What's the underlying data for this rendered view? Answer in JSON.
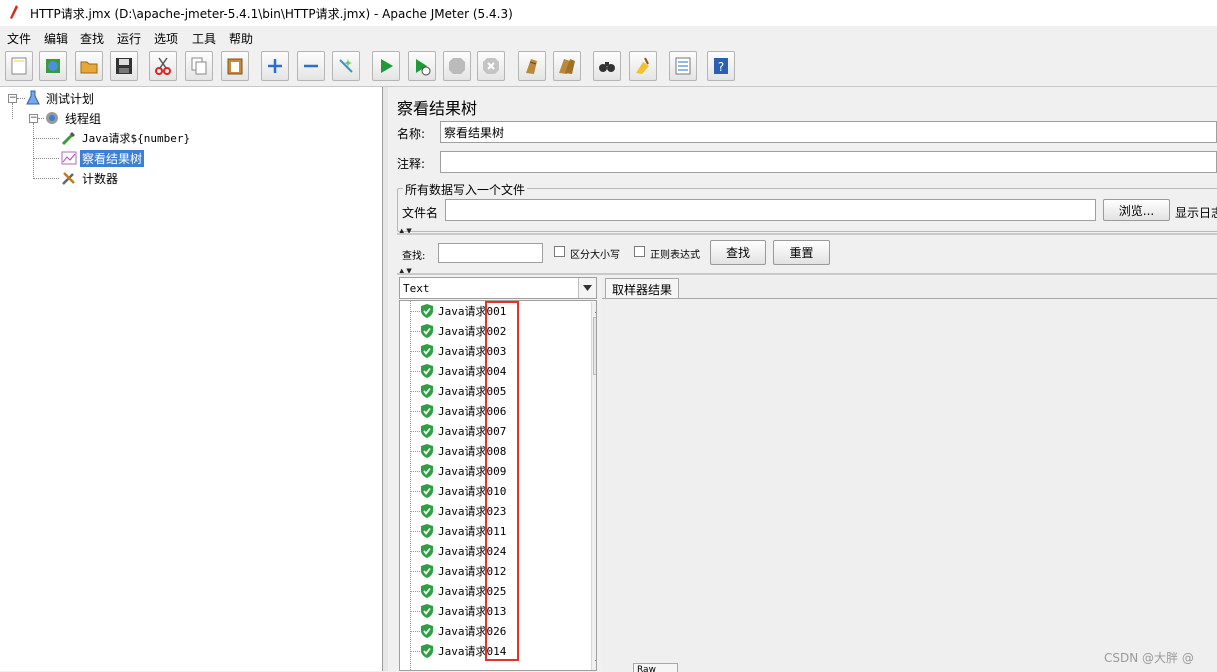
{
  "window": {
    "title": "HTTP请求.jmx (D:\\apache-jmeter-5.4.1\\bin\\HTTP请求.jmx) - Apache JMeter (5.4.3)"
  },
  "menu": [
    "文件",
    "编辑",
    "查找",
    "运行",
    "选项",
    "工具",
    "帮助"
  ],
  "toolbar": {
    "buttons": [
      "new",
      "templates",
      "open",
      "save",
      "cut",
      "copy",
      "paste",
      "expand",
      "collapse",
      "toggle",
      "start",
      "start-no-pauses",
      "stop",
      "shutdown",
      "clear",
      "clear-all",
      "search",
      "reset-search",
      "function-helper",
      "help"
    ]
  },
  "tree": {
    "test_plan": "测试计划",
    "thread_group": "线程组",
    "java_sampler": "Java请求${number}",
    "result_tree": "察看结果树",
    "counter": "计数器"
  },
  "panel": {
    "title": "察看结果树",
    "name_label": "名称:",
    "name_value": "察看结果树",
    "comment_label": "注释:",
    "comment_value": "",
    "file_section": "所有数据写入一个文件",
    "filename_label": "文件名",
    "filename_value": "",
    "browse_button": "浏览...",
    "log_label": "显示日志",
    "search_label": "查找:",
    "search_value": "",
    "case_sensitive": "区分大小写",
    "regex": "正则表达式",
    "find_button": "查找",
    "reset_button": "重置",
    "renderer_value": "Text",
    "tab_sampler_result": "取样器结果",
    "bottom_tab_partial": "Raw"
  },
  "results": [
    "Java请求001",
    "Java请求002",
    "Java请求003",
    "Java请求004",
    "Java请求005",
    "Java请求006",
    "Java请求007",
    "Java请求008",
    "Java请求009",
    "Java请求010",
    "Java请求023",
    "Java请求011",
    "Java请求024",
    "Java请求012",
    "Java请求025",
    "Java请求013",
    "Java请求026",
    "Java请求014"
  ],
  "colors": {
    "selection": "#3b7fd6",
    "success_icon": "#2ea043",
    "highlight_box": "#e8302a"
  },
  "watermark": "CSDN @大胖 @"
}
